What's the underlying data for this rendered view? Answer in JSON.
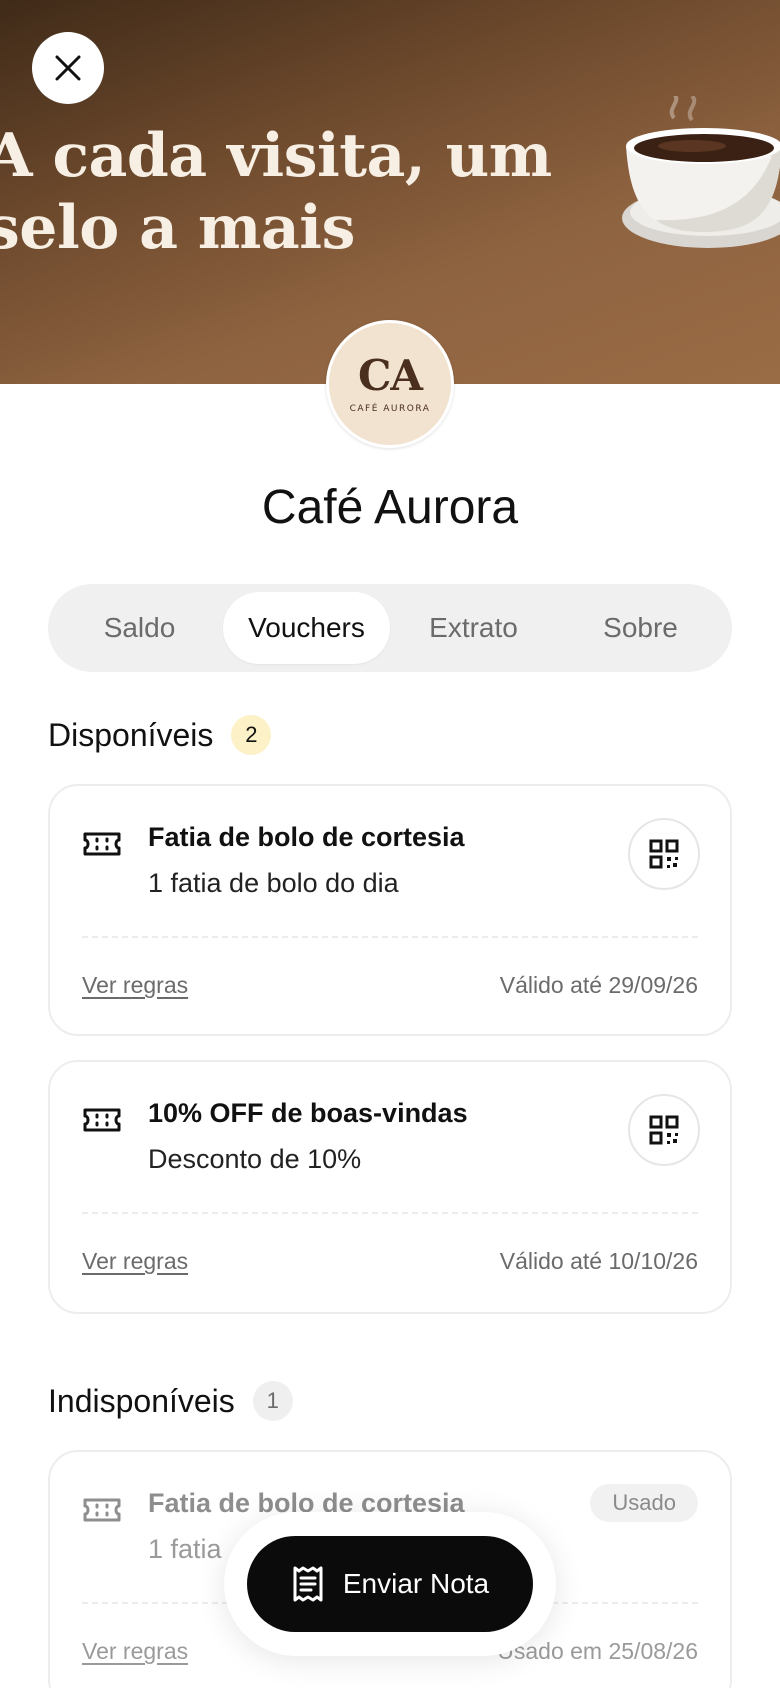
{
  "hero": {
    "title_line1": "A cada visita, um",
    "title_line2": "selo a mais"
  },
  "logo": {
    "monogram": "CA",
    "subtitle": "CAFÉ AURORA"
  },
  "store": {
    "name": "Café Aurora"
  },
  "tabs": [
    {
      "label": "Saldo",
      "active": false
    },
    {
      "label": "Vouchers",
      "active": true
    },
    {
      "label": "Extrato",
      "active": false
    },
    {
      "label": "Sobre",
      "active": false
    }
  ],
  "available": {
    "title": "Disponíveis",
    "count": "2",
    "vouchers": [
      {
        "title": "Fatia de bolo de cortesia",
        "description": "1 fatia de bolo do dia",
        "rules_label": "Ver regras",
        "validity": "Válido até 29/09/26"
      },
      {
        "title": "10% OFF de boas-vindas",
        "description": "Desconto de 10%",
        "rules_label": "Ver regras",
        "validity": "Válido até 10/10/26"
      }
    ]
  },
  "unavailable": {
    "title": "Indisponíveis",
    "count": "1",
    "vouchers": [
      {
        "title": "Fatia de bolo de cortesia",
        "description": "1 fatia",
        "status": "Usado",
        "rules_label": "Ver regras",
        "validity": "Usado em 25/08/26"
      }
    ]
  },
  "fab": {
    "label": "Enviar Nota",
    "icon": "receipt-icon"
  },
  "colors": {
    "hero_dark": "#3f2a18",
    "hero_light": "#9a6c45",
    "count_highlight": "#fdf1c7",
    "fab_bg": "#0b0b0b"
  }
}
